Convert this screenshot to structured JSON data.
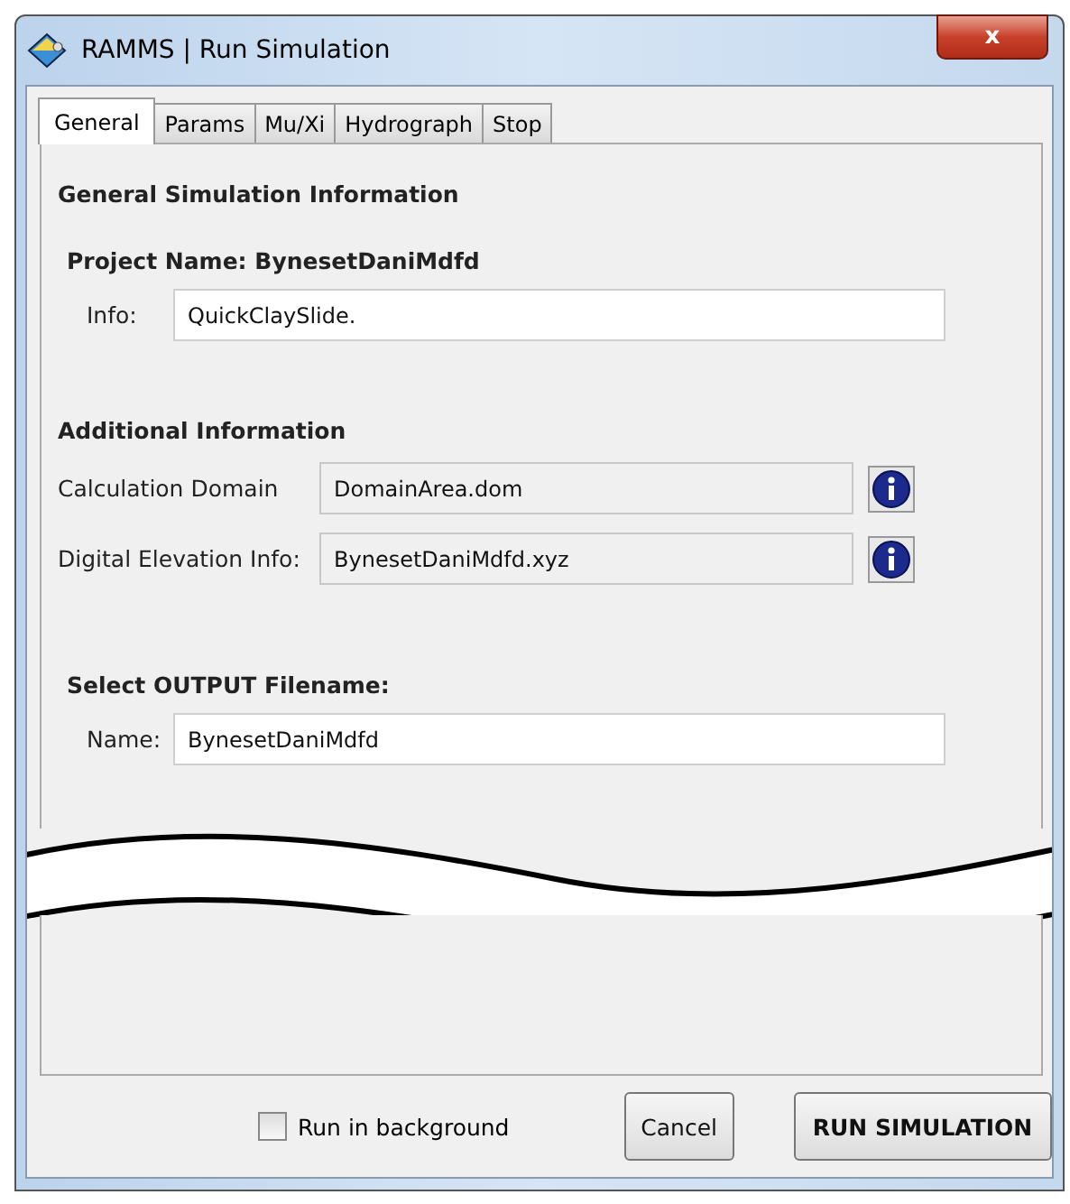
{
  "window": {
    "title": "RAMMS | Run Simulation",
    "close": "x"
  },
  "tabs": [
    {
      "label": "General",
      "selected": true
    },
    {
      "label": "Params",
      "selected": false
    },
    {
      "label": "Mu/Xi",
      "selected": false
    },
    {
      "label": "Hydrograph",
      "selected": false
    },
    {
      "label": "Stop",
      "selected": false
    }
  ],
  "general": {
    "heading": "General Simulation Information",
    "project_name": "Project Name: BynesetDaniMdfd",
    "info": {
      "label": "Info:",
      "value": "QuickClaySlide."
    }
  },
  "additional": {
    "heading": "Additional Information",
    "rows": [
      {
        "label": "Calculation Domain",
        "value": "DomainArea.dom"
      },
      {
        "label": "Digital Elevation Info:",
        "value": "BynesetDaniMdfd.xyz"
      }
    ]
  },
  "output": {
    "heading": "Select OUTPUT Filename:",
    "label": "Name:",
    "value": "BynesetDaniMdfd"
  },
  "footer": {
    "run_in_background": {
      "label": "Run in background",
      "checked": false
    },
    "buttons": [
      "Cancel",
      "RUN SIMULATION"
    ]
  }
}
